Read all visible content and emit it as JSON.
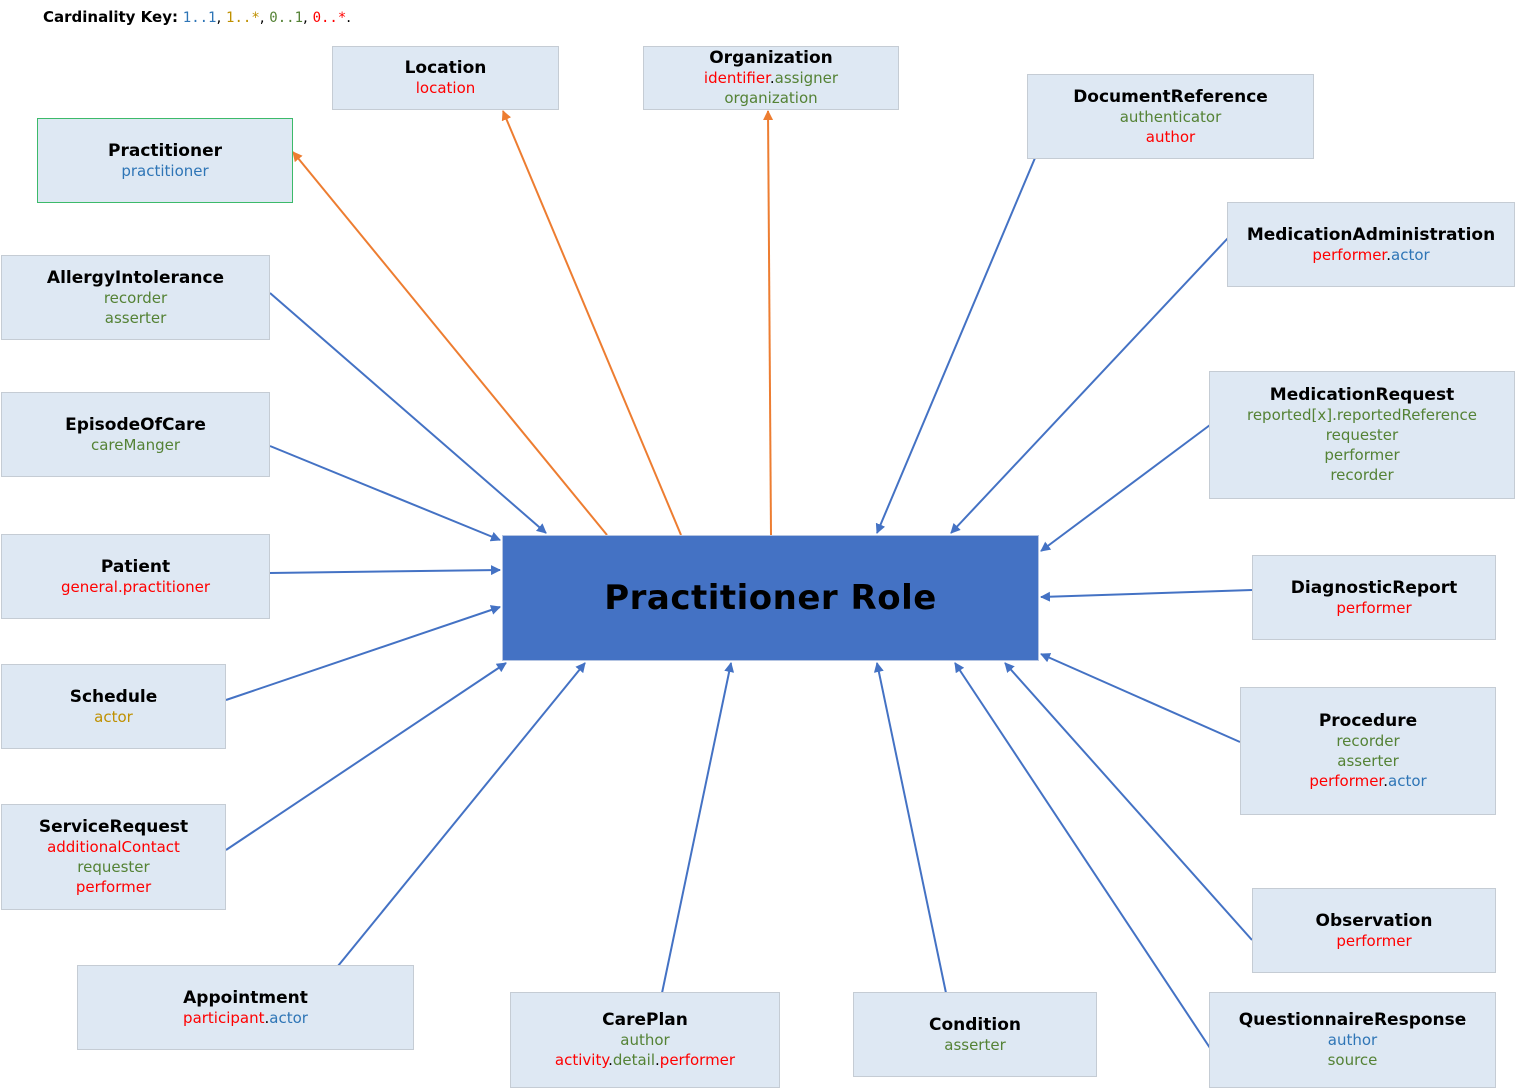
{
  "colors": {
    "c11": "#2e75b6",
    "c1n": "#bf9000",
    "c01": "#548235",
    "c0n": "#ff0000",
    "sep": "#000000",
    "arrow_in": "#4472c4",
    "arrow_out": "#ed7d31",
    "center_fill": "#4472c4"
  },
  "key": {
    "label": "Cardinality Key:",
    "items": [
      {
        "text": "1..1",
        "color": "c11"
      },
      {
        "text": "1..*",
        "color": "c1n"
      },
      {
        "text": "0..1",
        "color": "c01"
      },
      {
        "text": "0..*",
        "color": "c0n"
      }
    ]
  },
  "center": {
    "title": "Practitioner Role"
  },
  "nodes": [
    {
      "id": "location",
      "title": "Location",
      "direction": "out",
      "lines": [
        [
          {
            "t": "location",
            "c": "c0n"
          }
        ]
      ]
    },
    {
      "id": "organization",
      "title": "Organization",
      "direction": "out",
      "lines": [
        [
          {
            "t": "identifier",
            "c": "c0n"
          },
          {
            "t": ".",
            "c": "sep"
          },
          {
            "t": "assigner",
            "c": "c01"
          }
        ],
        [
          {
            "t": "organization",
            "c": "c01"
          }
        ]
      ]
    },
    {
      "id": "practitioner",
      "title": "Practitioner",
      "direction": "out",
      "highlight": true,
      "lines": [
        [
          {
            "t": "practitioner",
            "c": "c11"
          }
        ]
      ]
    },
    {
      "id": "documentreference",
      "title": "DocumentReference",
      "direction": "in",
      "lines": [
        [
          {
            "t": "authenticator",
            "c": "c01"
          }
        ],
        [
          {
            "t": "author",
            "c": "c0n"
          }
        ]
      ]
    },
    {
      "id": "medicationadministration",
      "title": "MedicationAdministration",
      "direction": "in",
      "lines": [
        [
          {
            "t": "performer",
            "c": "c0n"
          },
          {
            "t": ".",
            "c": "sep"
          },
          {
            "t": "actor",
            "c": "c11"
          }
        ]
      ]
    },
    {
      "id": "allergyintolerance",
      "title": "AllergyIntolerance",
      "direction": "in",
      "lines": [
        [
          {
            "t": "recorder",
            "c": "c01"
          }
        ],
        [
          {
            "t": "asserter",
            "c": "c01"
          }
        ]
      ]
    },
    {
      "id": "medicationrequest",
      "title": "MedicationRequest",
      "direction": "in",
      "lines": [
        [
          {
            "t": "reported[x].reportedReference",
            "c": "c01"
          }
        ],
        [
          {
            "t": "requester",
            "c": "c01"
          }
        ],
        [
          {
            "t": "performer",
            "c": "c01"
          }
        ],
        [
          {
            "t": "recorder",
            "c": "c01"
          }
        ]
      ]
    },
    {
      "id": "episodeofcare",
      "title": "EpisodeOfCare",
      "direction": "in",
      "lines": [
        [
          {
            "t": "careManger",
            "c": "c01"
          }
        ]
      ]
    },
    {
      "id": "patient",
      "title": "Patient",
      "direction": "in",
      "lines": [
        [
          {
            "t": "general.practitioner",
            "c": "c0n"
          }
        ]
      ]
    },
    {
      "id": "diagnosticreport",
      "title": "DiagnosticReport",
      "direction": "in",
      "lines": [
        [
          {
            "t": "performer",
            "c": "c0n"
          }
        ]
      ]
    },
    {
      "id": "schedule",
      "title": "Schedule",
      "direction": "in",
      "lines": [
        [
          {
            "t": "actor",
            "c": "c1n"
          }
        ]
      ]
    },
    {
      "id": "procedure",
      "title": "Procedure",
      "direction": "in",
      "lines": [
        [
          {
            "t": "recorder",
            "c": "c01"
          }
        ],
        [
          {
            "t": "asserter",
            "c": "c01"
          }
        ],
        [
          {
            "t": "performer",
            "c": "c0n"
          },
          {
            "t": ".",
            "c": "sep"
          },
          {
            "t": "actor",
            "c": "c11"
          }
        ]
      ]
    },
    {
      "id": "servicerequest",
      "title": "ServiceRequest",
      "direction": "in",
      "lines": [
        [
          {
            "t": "additionalContact",
            "c": "c0n"
          }
        ],
        [
          {
            "t": "requester",
            "c": "c01"
          }
        ],
        [
          {
            "t": "performer",
            "c": "c0n"
          }
        ]
      ]
    },
    {
      "id": "observation",
      "title": "Observation",
      "direction": "in",
      "lines": [
        [
          {
            "t": "performer",
            "c": "c0n"
          }
        ]
      ]
    },
    {
      "id": "appointment",
      "title": "Appointment",
      "direction": "in",
      "lines": [
        [
          {
            "t": "participant",
            "c": "c0n"
          },
          {
            "t": ".",
            "c": "sep"
          },
          {
            "t": "actor",
            "c": "c11"
          }
        ]
      ]
    },
    {
      "id": "careplan",
      "title": "CarePlan",
      "direction": "in",
      "lines": [
        [
          {
            "t": "author",
            "c": "c01"
          }
        ],
        [
          {
            "t": "activity",
            "c": "c0n"
          },
          {
            "t": ".",
            "c": "sep"
          },
          {
            "t": "detail",
            "c": "c01"
          },
          {
            "t": ".",
            "c": "sep"
          },
          {
            "t": "performer",
            "c": "c0n"
          }
        ]
      ]
    },
    {
      "id": "condition",
      "title": "Condition",
      "direction": "in",
      "lines": [
        [
          {
            "t": "asserter",
            "c": "c01"
          }
        ]
      ]
    },
    {
      "id": "questionnaireresponse",
      "title": "QuestionnaireResponse",
      "direction": "in",
      "lines": [
        [
          {
            "t": "author",
            "c": "c11"
          }
        ],
        [
          {
            "t": "source",
            "c": "c01"
          }
        ]
      ]
    }
  ]
}
